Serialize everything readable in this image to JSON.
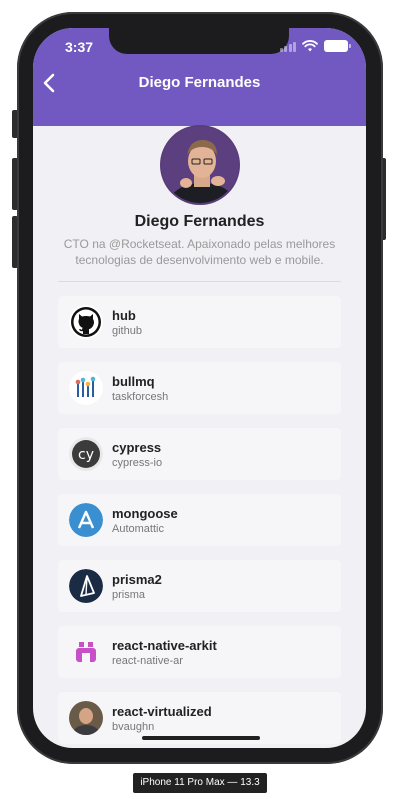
{
  "status_bar": {
    "time": "3:37"
  },
  "header": {
    "title": "Diego Fernandes"
  },
  "profile": {
    "name": "Diego Fernandes",
    "bio": "CTO na @Rocketseat. Apaixonado pelas melhores tecnologias de desenvolvimento web e mobile."
  },
  "repos": [
    {
      "name": "hub",
      "owner": "github",
      "icon": "github-octocat-icon"
    },
    {
      "name": "bullmq",
      "owner": "taskforcesh",
      "icon": "taskforce-icon"
    },
    {
      "name": "cypress",
      "owner": "cypress-io",
      "icon": "cypress-icon"
    },
    {
      "name": "mongoose",
      "owner": "Automattic",
      "icon": "automattic-icon"
    },
    {
      "name": "prisma2",
      "owner": "prisma",
      "icon": "prisma-icon"
    },
    {
      "name": "react-native-arkit",
      "owner": "react-native-ar",
      "icon": "react-native-ar-icon"
    },
    {
      "name": "react-virtualized",
      "owner": "bvaughn",
      "icon": "bvaughn-avatar"
    }
  ],
  "device_label": "iPhone 11 Pro Max — 13.3",
  "colors": {
    "accent": "#7159c1",
    "background": "#f0f0f5"
  }
}
